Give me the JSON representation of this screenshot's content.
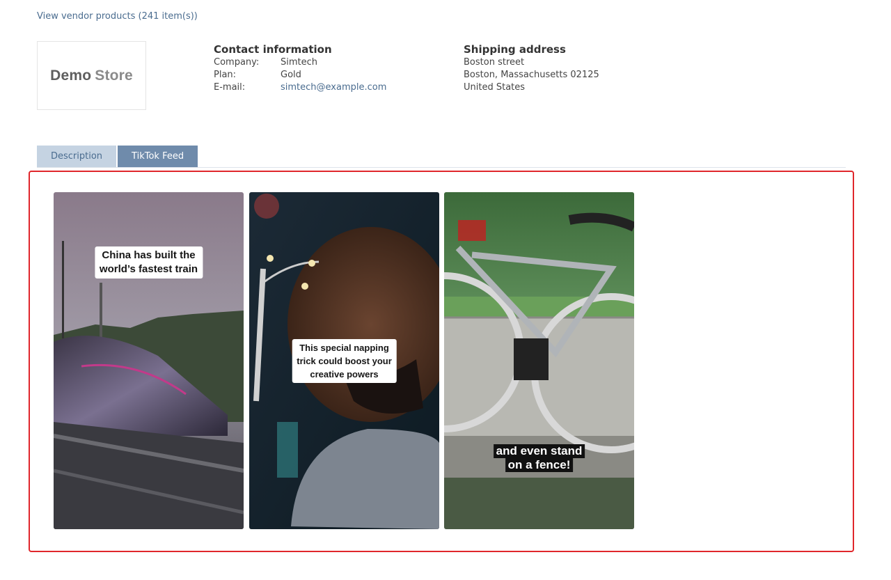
{
  "vendor_link": "View vendor products (241 item(s))",
  "logo": {
    "part1": "Demo",
    "part2": "Store"
  },
  "contact": {
    "title": "Contact information",
    "rows": [
      {
        "key": "Company:",
        "value": "Simtech"
      },
      {
        "key": "Plan:",
        "value": "Gold"
      },
      {
        "key": "E-mail:",
        "value": "simtech@example.com"
      }
    ]
  },
  "shipping": {
    "title": "Shipping address",
    "lines": [
      "Boston street",
      "Boston, Massachusetts 02125",
      "United States"
    ]
  },
  "tabs": [
    {
      "label": "Description",
      "active": false
    },
    {
      "label": "TikTok Feed",
      "active": true
    }
  ],
  "videos": [
    {
      "caption": [
        "China has built the",
        "world’s fastest train"
      ]
    },
    {
      "caption": [
        "This special napping",
        "trick could boost your",
        "creative powers"
      ]
    },
    {
      "caption": [
        "and even stand",
        "on a fence!"
      ]
    }
  ],
  "colors": {
    "link": "#4a6c8f",
    "tab_active": "#6f8bab",
    "tab_inactive": "#c5d3e2",
    "highlight_border": "#e0262b"
  }
}
